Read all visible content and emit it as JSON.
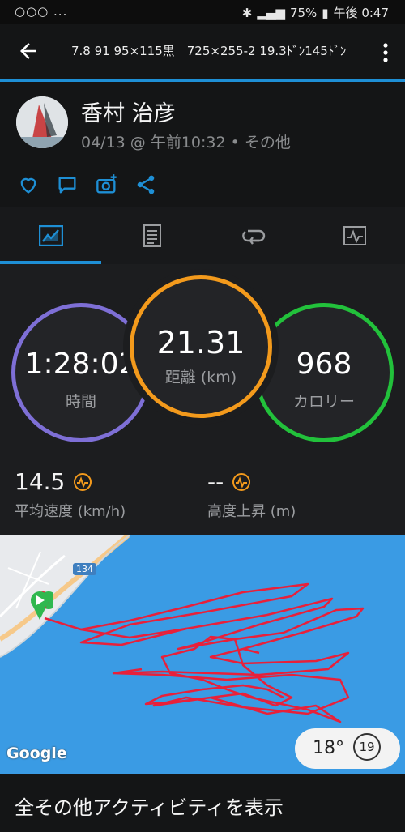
{
  "status": {
    "left": "○○○ ...",
    "battery": "75%",
    "time": "午後 0:47"
  },
  "header": {
    "title": "7.8 91 95×115黒　725×255-2 19.3ﾄﾞﾝ145ﾄﾞﾝ"
  },
  "profile": {
    "name": "香村 治彦",
    "meta": "04/13 @ 午前10:32 • その他"
  },
  "stats": {
    "time": {
      "value": "1:28:02",
      "label": "時間"
    },
    "distance": {
      "value": "21.31",
      "label": "距離 (km)"
    },
    "calories": {
      "value": "968",
      "label": "カロリー"
    },
    "avg_speed": {
      "value": "14.5",
      "label": "平均速度 (km/h)"
    },
    "elev_gain": {
      "value": "--",
      "label": "高度上昇 (m)"
    }
  },
  "map": {
    "road_label": "134",
    "google": "Google",
    "temperature": "18°",
    "wind": "19"
  },
  "footer": {
    "label": "全その他アクティビティを表示"
  },
  "colors": {
    "accent": "#1e8fd5",
    "time_ring": "#7e6fd6",
    "distance_ring": "#f39a1c",
    "calories_ring": "#22c13b",
    "route": "#e8203a"
  }
}
